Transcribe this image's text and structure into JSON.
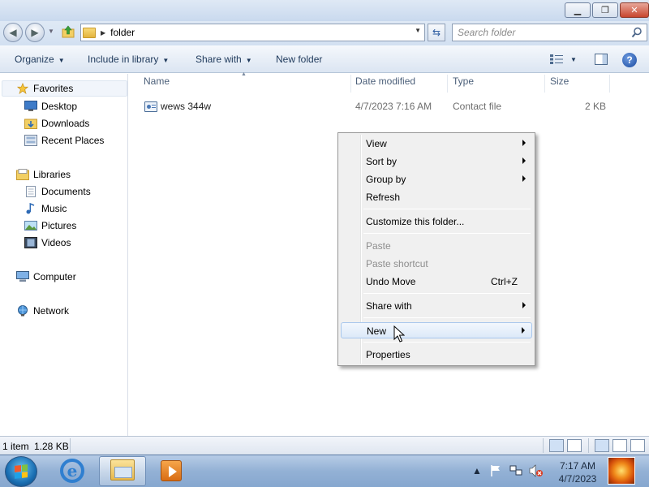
{
  "window": {
    "minimize_symbol": "▁",
    "restore_symbol": "❐",
    "close_symbol": "✕"
  },
  "address": {
    "path": "folder",
    "search_placeholder": "Search folder"
  },
  "toolbar": {
    "organize": "Organize",
    "include_in_library": "Include in library",
    "share_with": "Share with",
    "new_folder": "New folder",
    "help_symbol": "?"
  },
  "nav": {
    "favorites": "Favorites",
    "desktop": "Desktop",
    "downloads": "Downloads",
    "recent_places": "Recent Places",
    "libraries": "Libraries",
    "documents": "Documents",
    "music": "Music",
    "pictures": "Pictures",
    "videos": "Videos",
    "computer": "Computer",
    "network": "Network"
  },
  "columns": {
    "name": "Name",
    "date_modified": "Date modified",
    "type": "Type",
    "size": "Size"
  },
  "files": [
    {
      "name": "wews 344w",
      "date_modified": "4/7/2023 7:16 AM",
      "type": "Contact file",
      "size": "2 KB",
      "icon": "contact-file-icon"
    }
  ],
  "context_menu": {
    "view": "View",
    "sort_by": "Sort by",
    "group_by": "Group by",
    "refresh": "Refresh",
    "customize": "Customize this folder...",
    "paste": "Paste",
    "paste_shortcut": "Paste shortcut",
    "undo_move": "Undo Move",
    "undo_shortcut": "Ctrl+Z",
    "share_with": "Share with",
    "new": "New",
    "properties": "Properties",
    "highlighted_item": "New",
    "disabled_items": [
      "Paste",
      "Paste shortcut"
    ]
  },
  "status": {
    "items": "1 item",
    "size": "1.28 KB"
  },
  "taskbar": {
    "ie_letter": "e",
    "pinned": [
      "internet-explorer-icon",
      "windows-explorer-icon",
      "media-player-icon"
    ],
    "active_app": "windows-explorer-icon",
    "time": "7:17 AM",
    "date": "4/7/2023"
  },
  "colors": {
    "menu_background": "#f0f0f0",
    "menu_highlight": "#dce9f8",
    "disabled_text": "#8d8d8d",
    "toolbar_text": "#1e395b",
    "column_header_text": "#4c607a"
  }
}
